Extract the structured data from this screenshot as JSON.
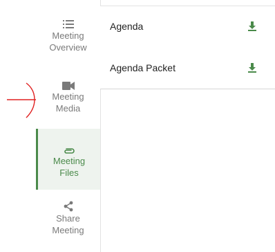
{
  "sidebar": {
    "items": [
      {
        "label": "Meeting\nOverview",
        "icon": "list-icon",
        "active": false
      },
      {
        "label": "Meeting\nMedia",
        "icon": "video-camera-icon",
        "active": false
      },
      {
        "label": "Meeting\nFiles",
        "icon": "paperclip-icon",
        "active": true
      },
      {
        "label": "Share\nMeeting",
        "icon": "share-icon",
        "active": false
      }
    ]
  },
  "files": [
    {
      "name": "Agenda",
      "icon": "download-icon"
    },
    {
      "name": "Agenda Packet",
      "icon": "download-icon"
    }
  ],
  "colors": {
    "accent": "#4a8a4a",
    "annotation": "#e02020",
    "muted_text": "#7a7a7a"
  }
}
